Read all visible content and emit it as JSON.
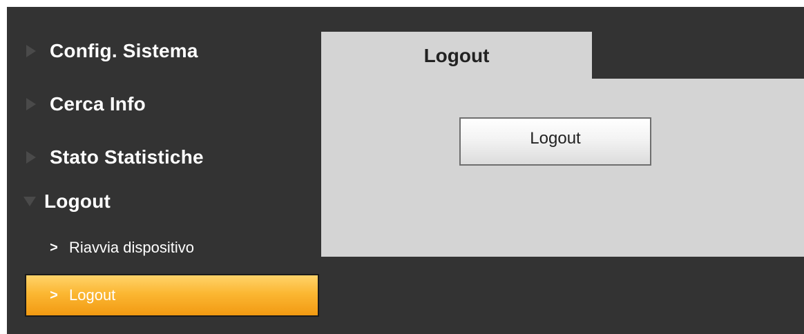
{
  "sidebar": {
    "items": [
      {
        "label": "Config. Sistema",
        "icon": "triangle-right-icon"
      },
      {
        "label": "Cerca Info",
        "icon": "triangle-right-icon"
      },
      {
        "label": "Stato Statistiche",
        "icon": "triangle-right-icon"
      },
      {
        "label": "Logout",
        "icon": "triangle-down-icon",
        "expanded": true
      }
    ],
    "subitems": [
      {
        "label": "Riavvia dispositivo",
        "icon": "chevron-right-icon",
        "chevron": ">"
      },
      {
        "label": "Logout",
        "icon": "chevron-right-icon",
        "chevron": ">",
        "active": true
      }
    ]
  },
  "main": {
    "tab_label": "Logout",
    "logout_button_label": "Logout"
  },
  "colors": {
    "background": "#333333",
    "panel": "#d4d4d4",
    "active_start": "#ffd36a",
    "active_end": "#f29a12"
  }
}
